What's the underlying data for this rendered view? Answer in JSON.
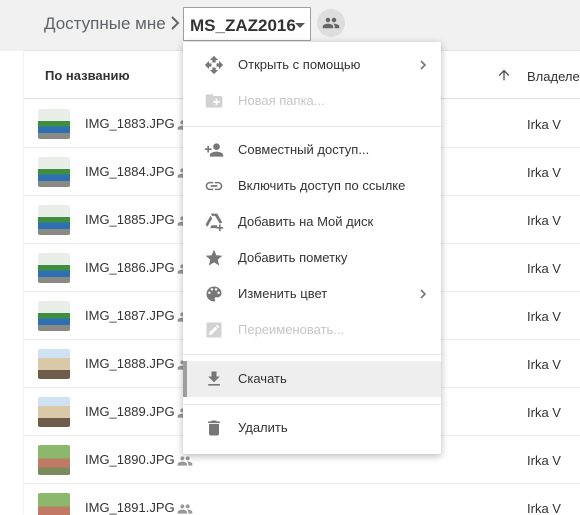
{
  "breadcrumb": {
    "root": "Доступные мне",
    "folder": "MS_ZAZ2016"
  },
  "header": {
    "name_col": "По названию",
    "owner_col": "Владелец"
  },
  "files": [
    {
      "name": "IMG_1883.JPG",
      "owner": "Irka V",
      "thumb": "car"
    },
    {
      "name": "IMG_1884.JPG",
      "owner": "Irka V",
      "thumb": "car"
    },
    {
      "name": "IMG_1885.JPG",
      "owner": "Irka V",
      "thumb": "car"
    },
    {
      "name": "IMG_1886.JPG",
      "owner": "Irka V",
      "thumb": "car"
    },
    {
      "name": "IMG_1887.JPG",
      "owner": "Irka V",
      "thumb": "car"
    },
    {
      "name": "IMG_1888.JPG",
      "owner": "Irka V",
      "thumb": "building"
    },
    {
      "name": "IMG_1889.JPG",
      "owner": "Irka V",
      "thumb": "building"
    },
    {
      "name": "IMG_1890.JPG",
      "owner": "Irka V",
      "thumb": "park"
    },
    {
      "name": "IMG_1891.JPG",
      "owner": "Irka V",
      "thumb": "park"
    }
  ],
  "menu": {
    "open_with": "Открыть с помощью",
    "new_folder": "Новая папка...",
    "share": "Совместный доступ...",
    "get_link": "Включить доступ по ссылке",
    "add_to_drive": "Добавить на Мой диск",
    "add_star": "Добавить пометку",
    "change_color": "Изменить цвет",
    "rename": "Переименовать...",
    "download": "Скачать",
    "delete": "Удалить"
  },
  "icons": {
    "folder_caret": "chevron-down-icon",
    "folder_share": "people-icon",
    "sort": "arrow-up-icon"
  },
  "colors": {
    "icon_gray": "#777777",
    "disabled_gray": "#c6c6c6",
    "hover_bg": "#eeeeee"
  }
}
